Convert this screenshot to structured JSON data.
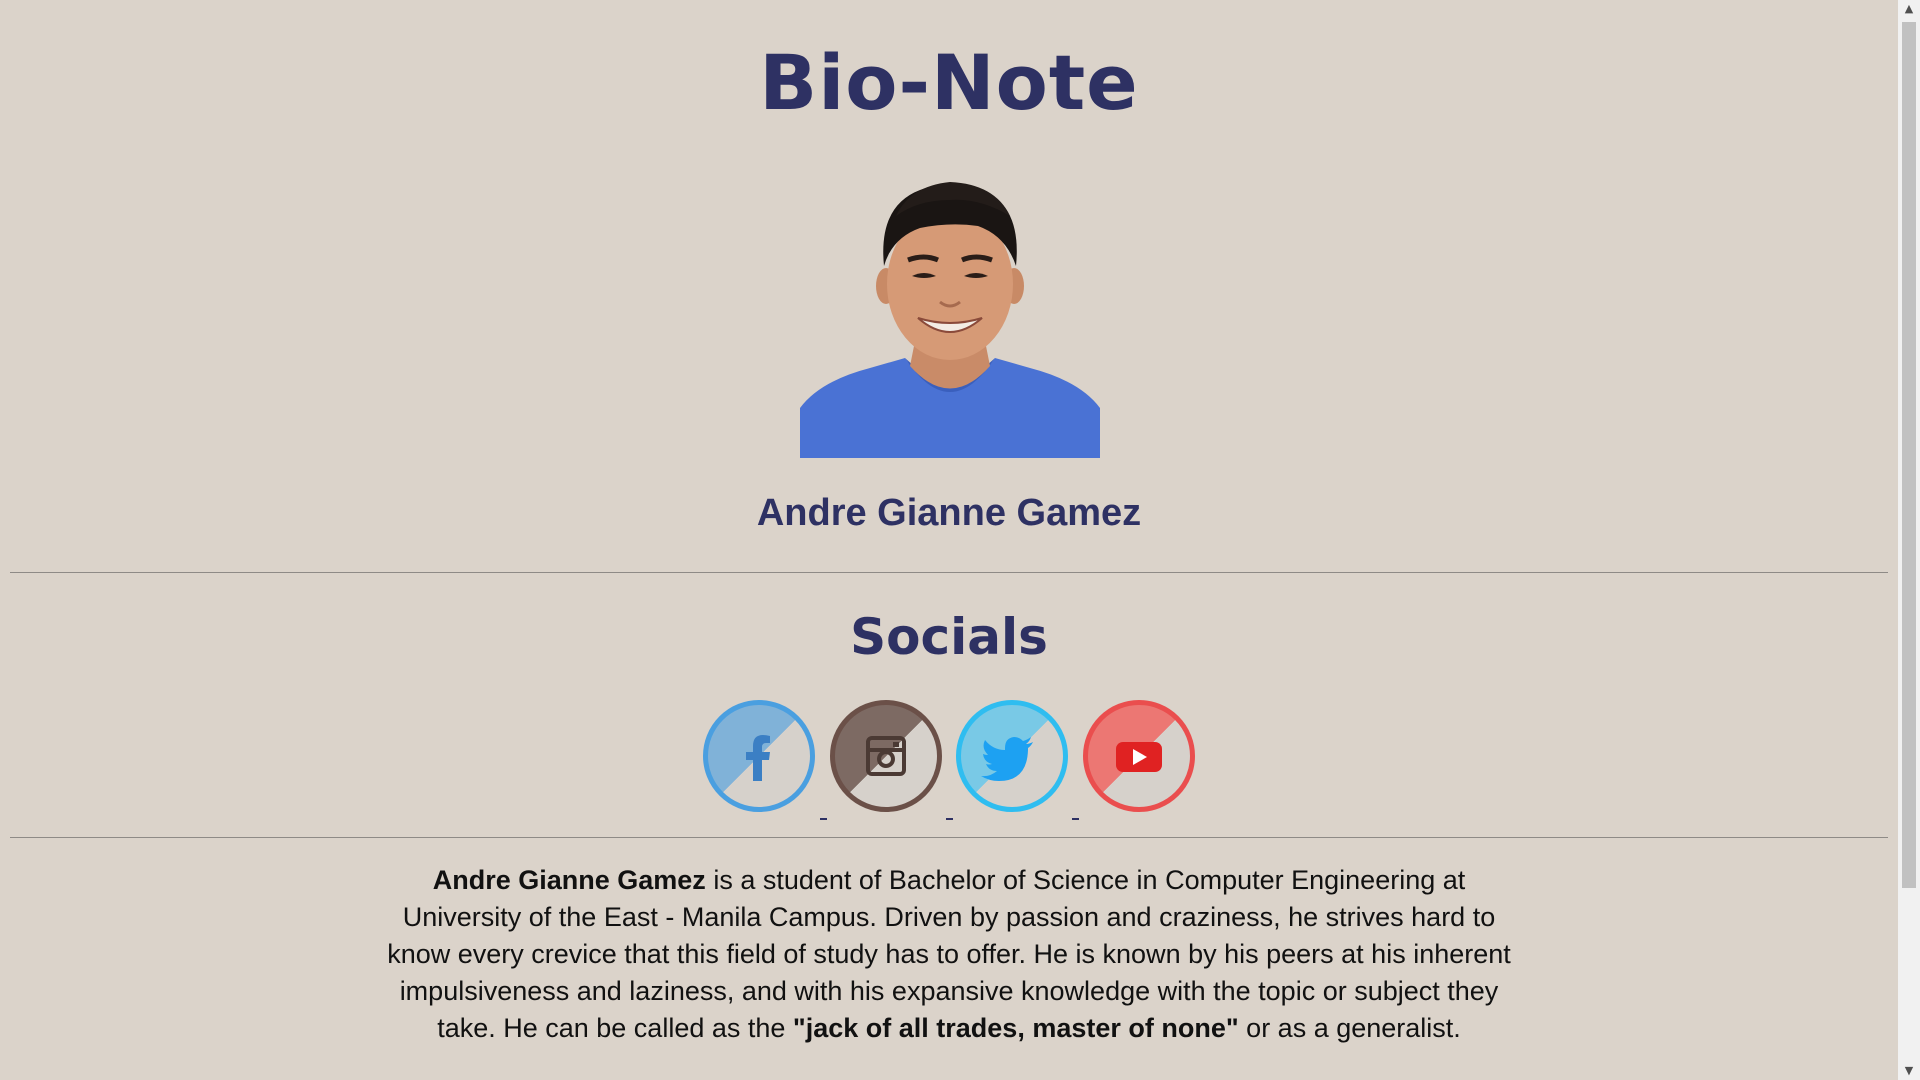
{
  "page": {
    "title": "Bio-Note",
    "name": "Andre Gianne Gamez",
    "socials_heading": "Socials"
  },
  "portrait": {
    "alt": "Portrait of Andre Gianne Gamez"
  },
  "socials": [
    {
      "id": "facebook",
      "icon": "facebook-icon",
      "color": "#4a9fe0"
    },
    {
      "id": "instagram",
      "icon": "instagram-icon",
      "color": "#6b5048"
    },
    {
      "id": "twitter",
      "icon": "twitter-icon",
      "color": "#2fbdf0"
    },
    {
      "id": "youtube",
      "icon": "youtube-icon",
      "color": "#ea4e4e"
    }
  ],
  "bio": {
    "name_bold": "Andre Gianne Gamez",
    "text_1": " is a student of Bachelor of Science in Computer Engineering at University of the East - Manila Campus. Driven by passion and craziness, he strives hard to know every crevice that this field of study has to offer. He is known by his peers at his inherent impulsiveness and laziness, and with his expansive knowledge with the topic or subject they take. He can be called as the ",
    "quote_bold": "\"jack of all trades, master of none\"",
    "text_2": " or as a generalist."
  },
  "colors": {
    "background": "#dbd3ca",
    "heading": "#2e3163"
  }
}
